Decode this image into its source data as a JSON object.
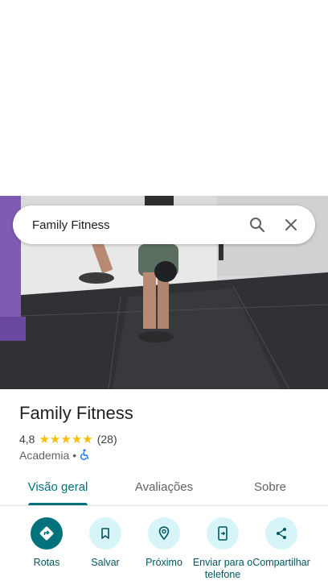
{
  "search": {
    "query": "Family Fitness"
  },
  "place": {
    "name": "Family Fitness",
    "rating": "4,8",
    "stars": 5,
    "review_count": "(28)",
    "category": "Academia",
    "separator": "•"
  },
  "tabs": [
    {
      "label": "Visão geral",
      "active": true
    },
    {
      "label": "Avaliações",
      "active": false
    },
    {
      "label": "Sobre",
      "active": false
    }
  ],
  "actions": [
    {
      "label": "Rotas",
      "icon": "directions-icon"
    },
    {
      "label": "Salvar",
      "icon": "bookmark-icon"
    },
    {
      "label": "Próximo",
      "icon": "nearby-icon"
    },
    {
      "label": "Enviar para o telefone",
      "icon": "send-to-phone-icon"
    },
    {
      "label": "Compartilhar",
      "icon": "share-icon"
    }
  ],
  "colors": {
    "accent": "#00727c",
    "action_bg": "#d7f4f8",
    "star": "#fbbc04"
  }
}
